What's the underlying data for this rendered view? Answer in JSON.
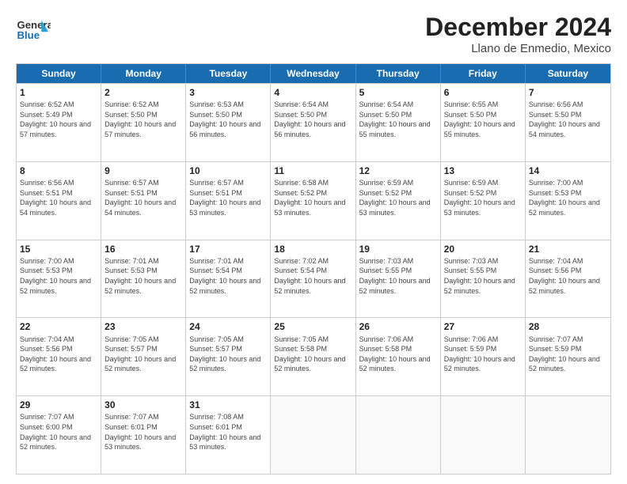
{
  "logo": {
    "line1": "General",
    "line2": "Blue"
  },
  "title": "December 2024",
  "subtitle": "Llano de Enmedio, Mexico",
  "weekdays": [
    "Sunday",
    "Monday",
    "Tuesday",
    "Wednesday",
    "Thursday",
    "Friday",
    "Saturday"
  ],
  "weeks": [
    [
      {
        "day": "1",
        "sunrise": "6:52 AM",
        "sunset": "5:49 PM",
        "daylight": "10 hours and 57 minutes."
      },
      {
        "day": "2",
        "sunrise": "6:52 AM",
        "sunset": "5:50 PM",
        "daylight": "10 hours and 57 minutes."
      },
      {
        "day": "3",
        "sunrise": "6:53 AM",
        "sunset": "5:50 PM",
        "daylight": "10 hours and 56 minutes."
      },
      {
        "day": "4",
        "sunrise": "6:54 AM",
        "sunset": "5:50 PM",
        "daylight": "10 hours and 56 minutes."
      },
      {
        "day": "5",
        "sunrise": "6:54 AM",
        "sunset": "5:50 PM",
        "daylight": "10 hours and 55 minutes."
      },
      {
        "day": "6",
        "sunrise": "6:55 AM",
        "sunset": "5:50 PM",
        "daylight": "10 hours and 55 minutes."
      },
      {
        "day": "7",
        "sunrise": "6:56 AM",
        "sunset": "5:50 PM",
        "daylight": "10 hours and 54 minutes."
      }
    ],
    [
      {
        "day": "8",
        "sunrise": "6:56 AM",
        "sunset": "5:51 PM",
        "daylight": "10 hours and 54 minutes."
      },
      {
        "day": "9",
        "sunrise": "6:57 AM",
        "sunset": "5:51 PM",
        "daylight": "10 hours and 54 minutes."
      },
      {
        "day": "10",
        "sunrise": "6:57 AM",
        "sunset": "5:51 PM",
        "daylight": "10 hours and 53 minutes."
      },
      {
        "day": "11",
        "sunrise": "6:58 AM",
        "sunset": "5:52 PM",
        "daylight": "10 hours and 53 minutes."
      },
      {
        "day": "12",
        "sunrise": "6:59 AM",
        "sunset": "5:52 PM",
        "daylight": "10 hours and 53 minutes."
      },
      {
        "day": "13",
        "sunrise": "6:59 AM",
        "sunset": "5:52 PM",
        "daylight": "10 hours and 53 minutes."
      },
      {
        "day": "14",
        "sunrise": "7:00 AM",
        "sunset": "5:53 PM",
        "daylight": "10 hours and 52 minutes."
      }
    ],
    [
      {
        "day": "15",
        "sunrise": "7:00 AM",
        "sunset": "5:53 PM",
        "daylight": "10 hours and 52 minutes."
      },
      {
        "day": "16",
        "sunrise": "7:01 AM",
        "sunset": "5:53 PM",
        "daylight": "10 hours and 52 minutes."
      },
      {
        "day": "17",
        "sunrise": "7:01 AM",
        "sunset": "5:54 PM",
        "daylight": "10 hours and 52 minutes."
      },
      {
        "day": "18",
        "sunrise": "7:02 AM",
        "sunset": "5:54 PM",
        "daylight": "10 hours and 52 minutes."
      },
      {
        "day": "19",
        "sunrise": "7:03 AM",
        "sunset": "5:55 PM",
        "daylight": "10 hours and 52 minutes."
      },
      {
        "day": "20",
        "sunrise": "7:03 AM",
        "sunset": "5:55 PM",
        "daylight": "10 hours and 52 minutes."
      },
      {
        "day": "21",
        "sunrise": "7:04 AM",
        "sunset": "5:56 PM",
        "daylight": "10 hours and 52 minutes."
      }
    ],
    [
      {
        "day": "22",
        "sunrise": "7:04 AM",
        "sunset": "5:56 PM",
        "daylight": "10 hours and 52 minutes."
      },
      {
        "day": "23",
        "sunrise": "7:05 AM",
        "sunset": "5:57 PM",
        "daylight": "10 hours and 52 minutes."
      },
      {
        "day": "24",
        "sunrise": "7:05 AM",
        "sunset": "5:57 PM",
        "daylight": "10 hours and 52 minutes."
      },
      {
        "day": "25",
        "sunrise": "7:05 AM",
        "sunset": "5:58 PM",
        "daylight": "10 hours and 52 minutes."
      },
      {
        "day": "26",
        "sunrise": "7:06 AM",
        "sunset": "5:58 PM",
        "daylight": "10 hours and 52 minutes."
      },
      {
        "day": "27",
        "sunrise": "7:06 AM",
        "sunset": "5:59 PM",
        "daylight": "10 hours and 52 minutes."
      },
      {
        "day": "28",
        "sunrise": "7:07 AM",
        "sunset": "5:59 PM",
        "daylight": "10 hours and 52 minutes."
      }
    ],
    [
      {
        "day": "29",
        "sunrise": "7:07 AM",
        "sunset": "6:00 PM",
        "daylight": "10 hours and 52 minutes."
      },
      {
        "day": "30",
        "sunrise": "7:07 AM",
        "sunset": "6:01 PM",
        "daylight": "10 hours and 53 minutes."
      },
      {
        "day": "31",
        "sunrise": "7:08 AM",
        "sunset": "6:01 PM",
        "daylight": "10 hours and 53 minutes."
      },
      null,
      null,
      null,
      null
    ]
  ]
}
